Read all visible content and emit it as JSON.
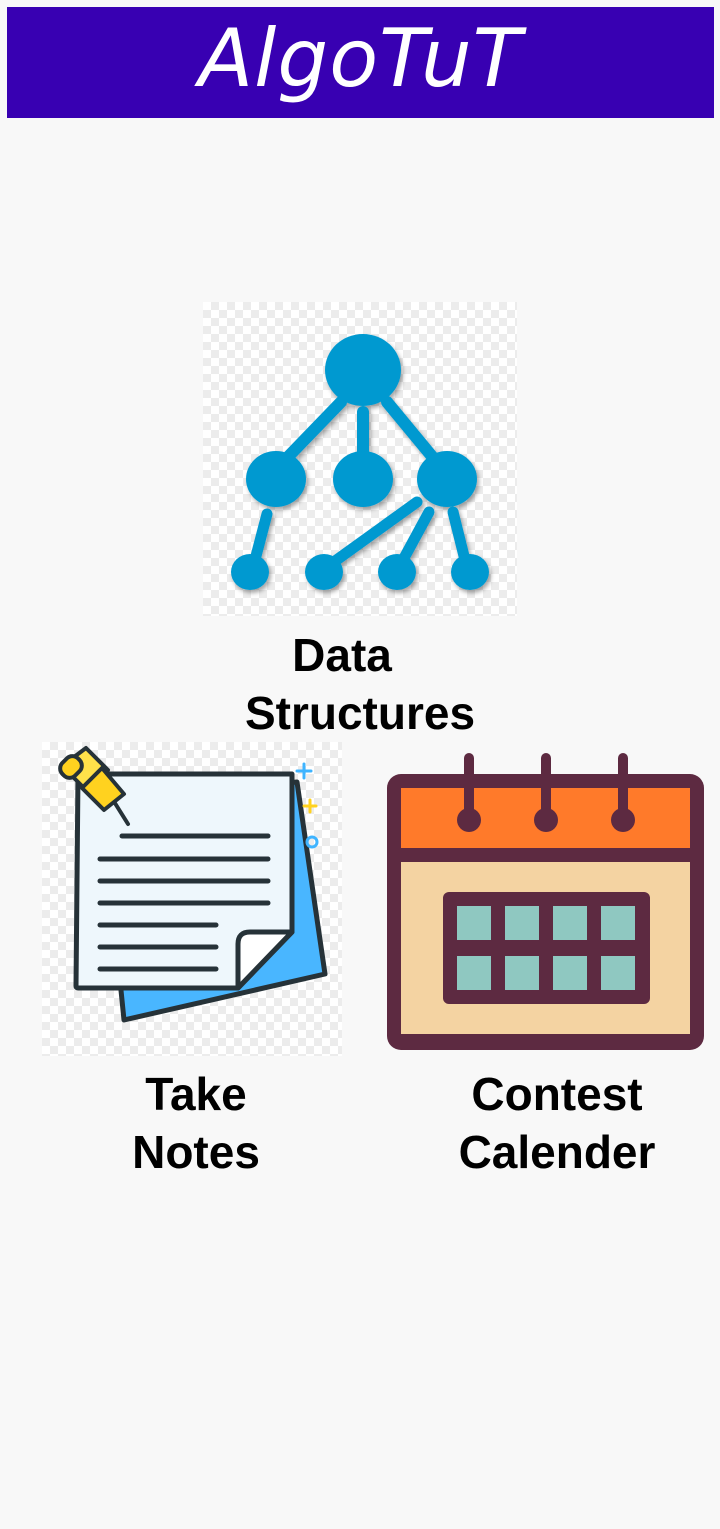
{
  "app": {
    "title": "AlgoTuT"
  },
  "menu": {
    "items": [
      {
        "label_line1": "Data",
        "label_line2": "Structures",
        "icon": "tree-structure-icon"
      },
      {
        "label_line1": "Take",
        "label_line2": "Notes",
        "icon": "notes-icon"
      },
      {
        "label_line1": "Contest",
        "label_line2": "Calender",
        "icon": "calendar-icon"
      }
    ]
  },
  "colors": {
    "header_bg": "#3800b2",
    "header_text": "#ffffff",
    "tree_blue": "#0099d0",
    "calendar_orange": "#ff7a2a",
    "calendar_frame": "#5d2a41",
    "notes_blue": "#49b6ff"
  }
}
